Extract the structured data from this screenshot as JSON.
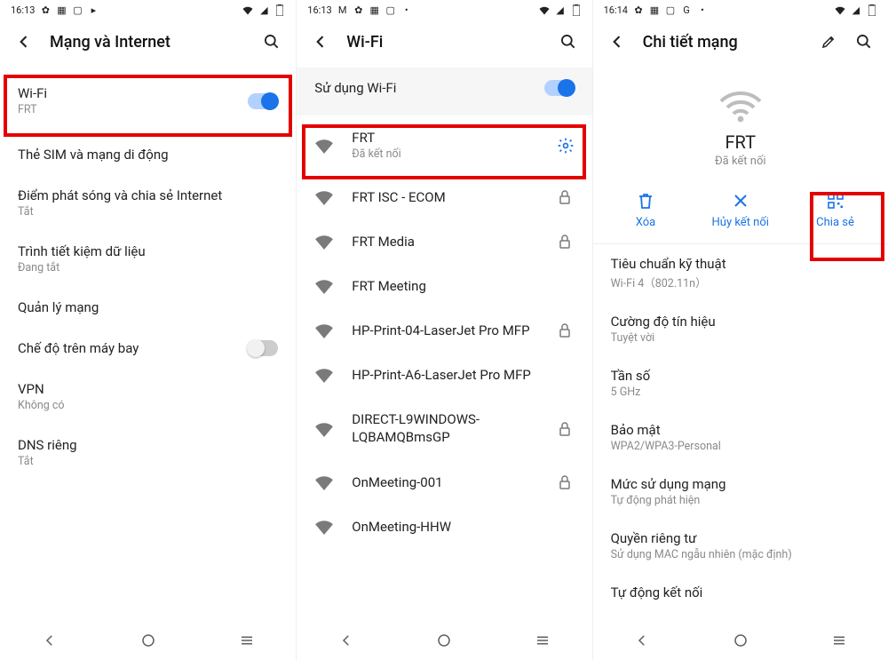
{
  "p1": {
    "status": {
      "time": "16:13",
      "icons_left": [
        "gear",
        "tile",
        "screen",
        "yt"
      ],
      "icons_right": [
        "wifi",
        "cell",
        "battery"
      ]
    },
    "title": "Mạng và Internet",
    "items": [
      {
        "t1": "Wi-Fi",
        "t2": "FRT",
        "toggle": "on"
      },
      {
        "t1": "Thẻ SIM và mạng di động",
        "t2": ""
      },
      {
        "t1": "Điểm phát sóng và chia sẻ Internet",
        "t2": "Tắt"
      },
      {
        "t1": "Trình tiết kiệm dữ liệu",
        "t2": "Đang tắt"
      },
      {
        "t1": "Quản lý mạng",
        "t2": ""
      },
      {
        "t1": "Chế độ trên máy bay",
        "t2": "",
        "toggle": "off"
      },
      {
        "t1": "VPN",
        "t2": "Không có"
      },
      {
        "t1": "DNS riêng",
        "t2": "Tắt"
      }
    ]
  },
  "p2": {
    "status": {
      "time": "16:13"
    },
    "title": "Wi-Fi",
    "use_wifi_label": "Sử dụng Wi-Fi",
    "use_wifi_toggle": "on",
    "networks": [
      {
        "name": "FRT",
        "sub": "Đã kết nối",
        "gear": true,
        "lock": false
      },
      {
        "name": "FRT ISC - ECOM",
        "lock": true
      },
      {
        "name": "FRT Media",
        "lock": true
      },
      {
        "name": "FRT Meeting",
        "lock": false
      },
      {
        "name": "HP-Print-04-LaserJet Pro MFP",
        "lock": true
      },
      {
        "name": "HP-Print-A6-LaserJet Pro MFP",
        "lock": false
      },
      {
        "name": "DIRECT-L9WINDOWS-LQBAMQBmsGP",
        "lock": true
      },
      {
        "name": "OnMeeting-001",
        "lock": true
      },
      {
        "name": "OnMeeting-HHW",
        "lock": false
      }
    ]
  },
  "p3": {
    "status": {
      "time": "16:14"
    },
    "title": "Chi tiết mạng",
    "net_name": "FRT",
    "net_status": "Đã kết nối",
    "actions": [
      {
        "icon": "trash",
        "label": "Xóa"
      },
      {
        "icon": "x",
        "label": "Hủy kết nối"
      },
      {
        "icon": "qr",
        "label": "Chia sẻ"
      }
    ],
    "details": [
      {
        "d1": "Tiêu chuẩn kỹ thuật",
        "d2": "Wi-Fi 4（802.11n）"
      },
      {
        "d1": "Cường độ tín hiệu",
        "d2": "Tuyệt vời"
      },
      {
        "d1": "Tần số",
        "d2": "5 GHz"
      },
      {
        "d1": "Bảo mật",
        "d2": "WPA2/WPA3-Personal"
      },
      {
        "d1": "Mức sử dụng mạng",
        "d2": "Tự động phát hiện"
      },
      {
        "d1": "Quyền riêng tư",
        "d2": "Sử dụng MAC ngẫu nhiên (mặc định)"
      },
      {
        "d1": "Tự động kết nối",
        "d2": ""
      }
    ]
  }
}
